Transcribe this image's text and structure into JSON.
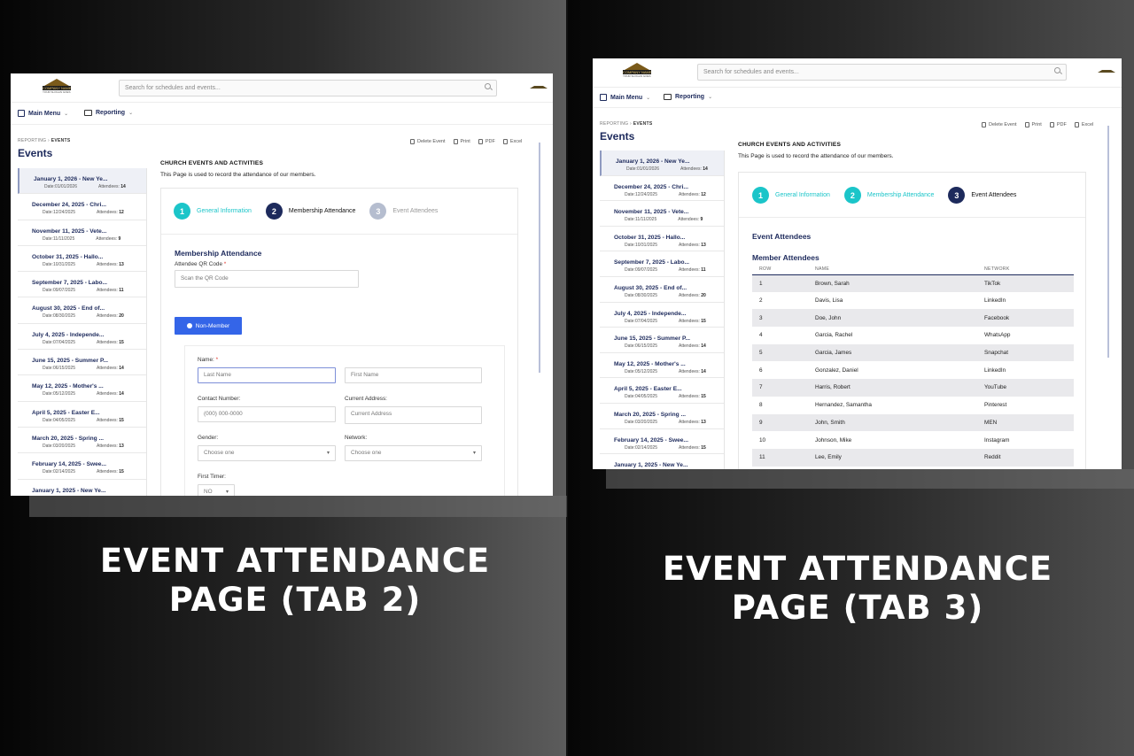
{
  "colors": {
    "brand_navy": "#1d2a5c",
    "teal": "#1bc5c9",
    "button_blue": "#3465e8",
    "gray_step": "#b5bdcf"
  },
  "common": {
    "logo_name": "COMPANY NAME",
    "logo_tagline": "YOUR SLOGAN GOES HERE",
    "search_placeholder": "Search for schedules and events...",
    "main_menu": "Main Menu",
    "reporting": "Reporting",
    "crumb_parent": "REPORTING",
    "crumb_current": "EVENTS",
    "page_title": "Events",
    "actions": [
      "Delete Event",
      "Print",
      "PDF",
      "Excel"
    ],
    "section_title": "CHURCH EVENTS AND ACTIVITIES",
    "section_sub": "This Page is used to record the attendance of our members.",
    "steps": [
      "General Information",
      "Membership Attendance",
      "Event Attendees"
    ]
  },
  "events": [
    {
      "title": "January 1, 2026 - New Ye...",
      "date": "Date:01/01/2026",
      "attendees": "14"
    },
    {
      "title": "December 24, 2025 - Chri...",
      "date": "Date:12/24/2025",
      "attendees": "12"
    },
    {
      "title": "November 11, 2025 - Vete...",
      "date": "Date:11/11/2025",
      "attendees": "9"
    },
    {
      "title": "October 31, 2025 - Hallo...",
      "date": "Date:10/31/2025",
      "attendees": "13"
    },
    {
      "title": "September 7, 2025 - Labo...",
      "date": "Date:09/07/2025",
      "attendees": "11"
    },
    {
      "title": "August 30, 2025 - End of...",
      "date": "Date:08/30/2025",
      "attendees": "20"
    },
    {
      "title": "July 4, 2025 - Independe...",
      "date": "Date:07/04/2025",
      "attendees": "15"
    },
    {
      "title": "June 15, 2025 - Summer P...",
      "date": "Date:06/15/2025",
      "attendees": "14"
    },
    {
      "title": "May 12, 2025 - Mother's ...",
      "date": "Date:05/12/2025",
      "attendees": "14"
    },
    {
      "title": "April 5, 2025 - Easter E...",
      "date": "Date:04/05/2025",
      "attendees": "15"
    },
    {
      "title": "March 20, 2025 - Spring ...",
      "date": "Date:03/20/2025",
      "attendees": "13"
    },
    {
      "title": "February 14, 2025 - Swee...",
      "date": "Date:02/14/2025",
      "attendees": "15"
    },
    {
      "title": "January 1, 2025 - New Ye...",
      "date": "",
      "attendees": ""
    }
  ],
  "attendees_label": "Attendees:",
  "tab2": {
    "caption": [
      "EVENT ATTENDANCE",
      "PAGE (TAB 2)"
    ],
    "form_title": "Membership Attendance",
    "qr_label": "Attendee QR Code",
    "qr_placeholder": "Scan the QR Code",
    "non_member_button": "Non-Member",
    "name_label": "Name:",
    "last_name_placeholder": "Last Name",
    "first_name_placeholder": "First Name",
    "contact_label": "Contact Number:",
    "contact_placeholder": "(000) 000-0000",
    "address_label": "Current Address:",
    "address_placeholder": "Current Address",
    "gender_label": "Gender:",
    "gender_value": "Choose one",
    "network_label": "Network:",
    "network_value": "Choose one",
    "first_timer_label": "First Timer:",
    "first_timer_value": "NO"
  },
  "tab3": {
    "caption": [
      "EVENT ATTENDANCE",
      "PAGE (TAB 3)"
    ],
    "event_attendees_title": "Event Attendees",
    "member_attendees_title": "Member Attendees",
    "columns": [
      "ROW",
      "NAME",
      "NETWORK"
    ],
    "rows": [
      [
        "1",
        "Brown, Sarah",
        "TikTok"
      ],
      [
        "2",
        "Davis, Lisa",
        "LinkedIn"
      ],
      [
        "3",
        "Doe, John",
        "Facebook"
      ],
      [
        "4",
        "Garcia, Rachel",
        "WhatsApp"
      ],
      [
        "5",
        "Garcia, James",
        "Snapchat"
      ],
      [
        "6",
        "Gonzalez, Daniel",
        "LinkedIn"
      ],
      [
        "7",
        "Harris, Robert",
        "YouTube"
      ],
      [
        "8",
        "Hernandez, Samantha",
        "Pinterest"
      ],
      [
        "9",
        "John, Smith",
        "MEN"
      ],
      [
        "10",
        "Johnson, Mike",
        "Instagram"
      ],
      [
        "11",
        "Lee, Emily",
        "Reddit"
      ]
    ]
  }
}
